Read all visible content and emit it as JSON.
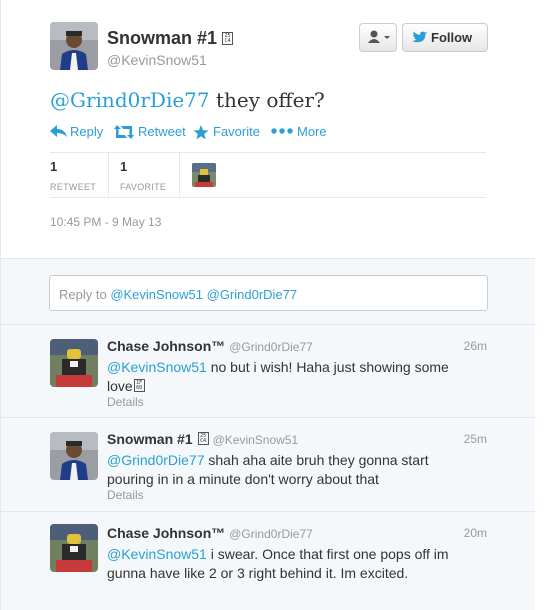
{
  "tweet": {
    "author_name": "Snowman #1",
    "author_handle": "@KevinSnow51",
    "text_mention": "@Grind0rDie77",
    "text_body": " they offer?",
    "actions": {
      "reply": "Reply",
      "retweet": "Retweet",
      "favorite": "Favorite",
      "more": "More"
    },
    "stats": {
      "retweets": "1",
      "retweets_label": "RETWEET",
      "favorites": "1",
      "favorites_label": "FAVORITE"
    },
    "timestamp": "10:45 PM - 9 May 13",
    "follow_label": "Follow"
  },
  "reply_box": {
    "prefix": "Reply to ",
    "mentions": "@KevinSnow51 @Grind0rDie77"
  },
  "replies": [
    {
      "name": "Chase Johnson™",
      "handle": "@Grind0rDie77",
      "time": "26m",
      "mention": "@KevinSnow51",
      "text": " no but i wish! Haha just showing some love",
      "details": "Details"
    },
    {
      "name": "Snowman #1",
      "handle": "@KevinSnow51",
      "time": "25m",
      "mention": "@Grind0rDie77",
      "text": " shah aha aite bruh they gonna start pouring in in a minute don't worry about that",
      "details": "Details"
    },
    {
      "name": "Chase Johnson™",
      "handle": "@Grind0rDie77",
      "time": "20m",
      "mention": "@KevinSnow51",
      "text": " i swear. Once that first one pops off im gunna have like 2 or 3 right behind it. Im excited.",
      "details": ""
    }
  ],
  "colors": {
    "link": "#2a9fd6",
    "muted": "#999999",
    "text": "#333333",
    "bg_alt": "#f5f8fa"
  },
  "icons": [
    "reply-icon",
    "retweet-icon",
    "star-icon",
    "more-dots-icon",
    "user-icon",
    "twitter-bird-icon",
    "emoji-glyph-icon"
  ]
}
